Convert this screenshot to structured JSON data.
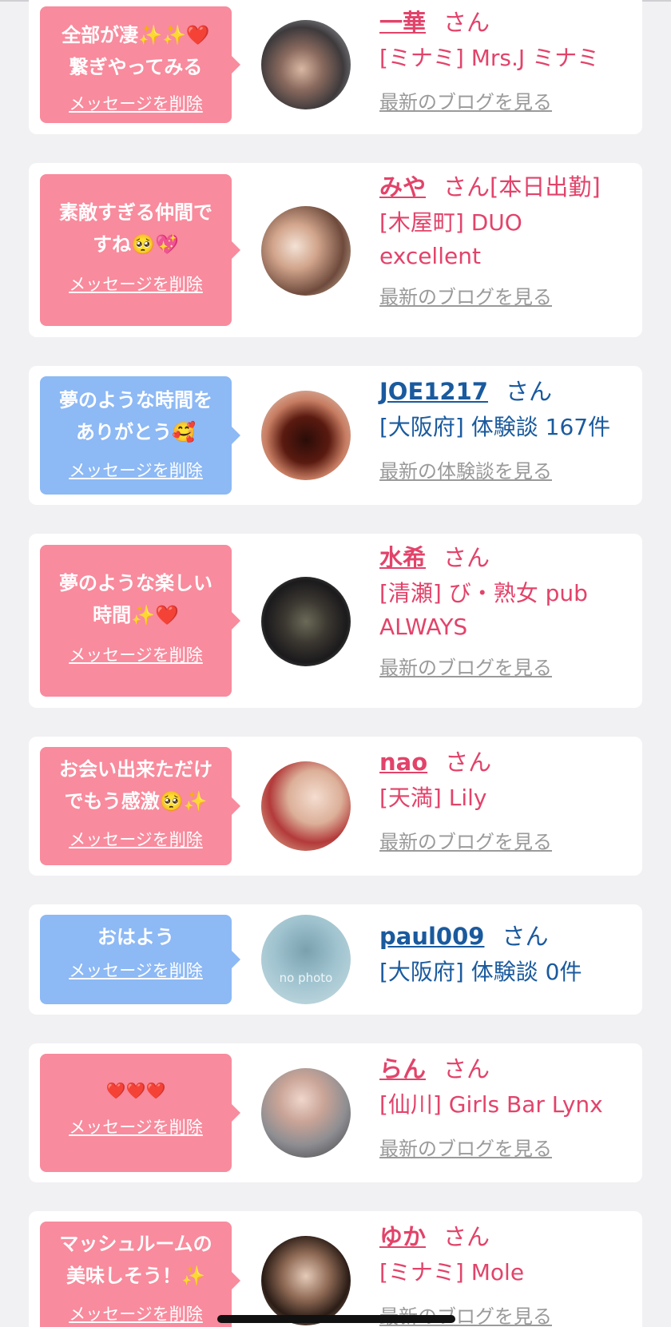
{
  "delete_label": "メッセージを削除",
  "san_label": "さん",
  "items": [
    {
      "message": "全部が凄✨✨❤️\n繋ぎやってみる",
      "name": "一華",
      "detail": "[ミナミ] Mrs.J ミナミ",
      "link": "最新のブログを見る",
      "type": "cast"
    },
    {
      "message": "素敵すぎる仲間で\nすね🥺💖",
      "name": "みや",
      "name_suffix": "[本日出勤]",
      "detail": "[木屋町] DUO\nexcellent",
      "link": "最新のブログを見る",
      "type": "cast"
    },
    {
      "message": "夢のような時間を\nありがとう🥰",
      "name": "JOE1217",
      "detail": "[大阪府] 体験談 167件",
      "link": "最新の体験談を見る",
      "type": "user"
    },
    {
      "message": "夢のような楽しい\n時間✨❤️",
      "name": "水希",
      "detail": "[清瀬] び・熟女 pub\nALWAYS",
      "link": "最新のブログを見る",
      "type": "cast"
    },
    {
      "message": "お会い出来ただけ\nでもう感激🥺✨",
      "name": "nao",
      "detail": "[天満] Lily",
      "link": "最新のブログを見る",
      "type": "cast"
    },
    {
      "message": "おはよう",
      "name": "paul009",
      "detail": "[大阪府] 体験談 0件",
      "avatar_text": "no photo",
      "type": "user"
    },
    {
      "message": "❤️❤️❤️",
      "name": "らん",
      "detail": "[仙川] Girls Bar Lynx",
      "link": "最新のブログを見る",
      "type": "cast"
    },
    {
      "message": "マッシュルームの\n美味しそう！✨",
      "name": "ゆか",
      "detail": "[ミナミ] Mole",
      "link": "最新のブログを見る",
      "type": "cast"
    }
  ],
  "colors": {
    "pink_bubble": "#f88b9d",
    "blue_bubble": "#8db9f5",
    "cast_text": "#e2436a",
    "user_text": "#1a5a9e",
    "link_gray": "#9a9a9a",
    "background": "#f1f1f3"
  }
}
